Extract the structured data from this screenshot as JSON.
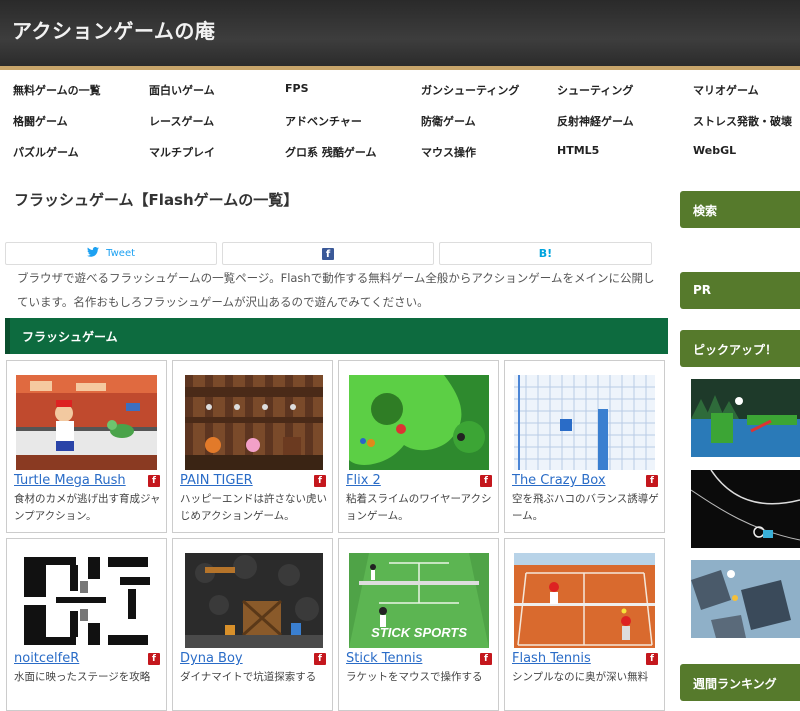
{
  "header": {
    "site_title": "アクションゲームの庵"
  },
  "nav": {
    "rows": [
      [
        "無料ゲームの一覧",
        "面白いゲーム",
        "FPS",
        "ガンシューティング",
        "シューティング",
        "マリオゲーム"
      ],
      [
        "格闘ゲーム",
        "レースゲーム",
        "アドベンチャー",
        "防衛ゲーム",
        "反射神経ゲーム",
        "ストレス発散・破壊"
      ],
      [
        "パズルゲーム",
        "マルチプレイ",
        "グロ系 残酷ゲーム",
        "マウス操作",
        "HTML5",
        "WebGL"
      ]
    ]
  },
  "main": {
    "heading": "フラッシュゲーム【Flashゲームの一覧】",
    "share": {
      "tweet": "Tweet",
      "facebook": "f",
      "hatena": "B!"
    },
    "intro": "ブラウザで遊べるフラッシュゲームの一覧ページ。Flashで動作する無料ゲーム全般からアクションゲームをメインに公開しています。名作おもしろフラッシュゲームが沢山あるので遊んでみてください。",
    "section_title": "フラッシュゲーム",
    "flash_badge": "f",
    "games": [
      {
        "title": "Turtle Mega Rush",
        "desc": "食材のカメが逃げ出す育成ジャンプアクション。"
      },
      {
        "title": "PAIN TIGER",
        "desc": "ハッピーエンドは許さない虎いじめアクションゲーム。"
      },
      {
        "title": "Flix 2",
        "desc": "粘着スライムのワイヤーアクションゲーム。"
      },
      {
        "title": "The Crazy Box",
        "desc": "空を飛ぶハコのバランス誘導ゲーム。"
      },
      {
        "title": "noitcelfeR",
        "desc": "水面に映ったステージを攻略"
      },
      {
        "title": "Dyna Boy",
        "desc": "ダイナマイトで坑道探索する"
      },
      {
        "title": "Stick Tennis",
        "desc": "ラケットをマウスで操作する"
      },
      {
        "title": "Flash Tennis",
        "desc": "シンプルなのに奥が深い無料"
      }
    ],
    "thumb_text": {
      "stick_logo": "STICK SPORTS"
    }
  },
  "sidebar": {
    "search": "検索",
    "pr": "PR",
    "pickup": "ピックアップ！",
    "ranking": "週間ランキング"
  },
  "colors": {
    "header_bg": "#333333",
    "header_border": "#c8a56a",
    "section_green": "#0d6b3f",
    "sidebar_green": "#567a2c",
    "link_blue": "#2a6cc7",
    "flash_red": "#c4171d"
  }
}
